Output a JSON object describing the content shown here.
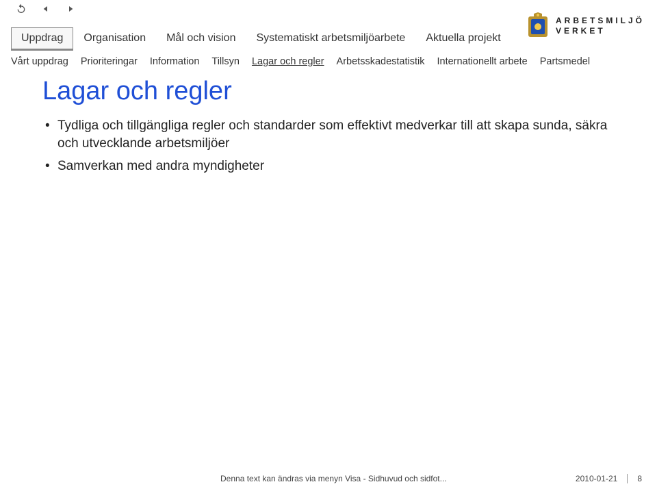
{
  "toolbar": {
    "undo": "undo",
    "prev": "previous",
    "next": "next"
  },
  "primaryTabs": [
    {
      "label": "Uppdrag",
      "active": true
    },
    {
      "label": "Organisation",
      "active": false
    },
    {
      "label": "Mål och vision",
      "active": false
    },
    {
      "label": "Systematiskt arbetsmiljöarbete",
      "active": false
    },
    {
      "label": "Aktuella projekt",
      "active": false
    }
  ],
  "secondaryTabs": [
    {
      "label": "Vårt uppdrag",
      "active": false
    },
    {
      "label": "Prioriteringar",
      "active": false
    },
    {
      "label": "Information",
      "active": false
    },
    {
      "label": "Tillsyn",
      "active": false
    },
    {
      "label": "Lagar och regler",
      "active": true
    },
    {
      "label": "Arbetsskadestatistik",
      "active": false
    },
    {
      "label": "Internationellt arbete",
      "active": false
    },
    {
      "label": "Partsmedel",
      "active": false
    }
  ],
  "logo": {
    "line1": "ARBETSMILJÖ",
    "line2": "VERKET"
  },
  "page": {
    "title": "Lagar och regler",
    "bullets": [
      "Tydliga och tillgängliga regler och standarder som effektivt medverkar till att skapa sunda, säkra och utvecklande arbetsmiljöer",
      "Samverkan med andra myndigheter"
    ]
  },
  "footer": {
    "note": "Denna text kan ändras via menyn Visa - Sidhuvud och sidfot...",
    "date": "2010-01-21",
    "pageNum": "8"
  }
}
